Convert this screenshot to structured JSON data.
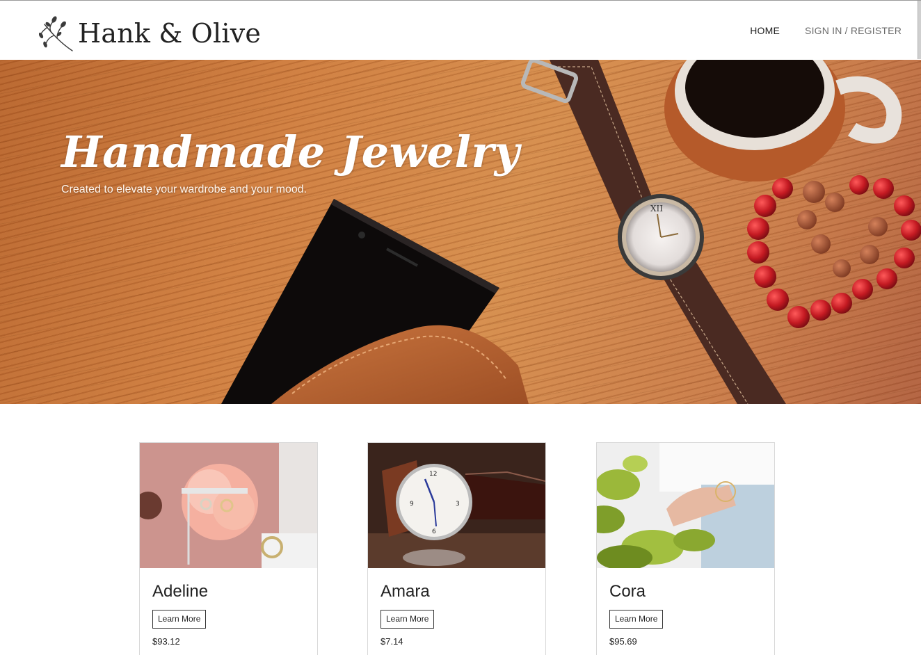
{
  "header": {
    "brand": "Hank & Olive",
    "nav": {
      "home": "HOME",
      "signin": "SIGN IN / REGISTER"
    }
  },
  "hero": {
    "title": "Handmade Jewelry",
    "subtitle": "Created to elevate your wardrobe and your mood."
  },
  "products": [
    {
      "name": "Adeline",
      "button": "Learn More",
      "price": "$93.12"
    },
    {
      "name": "Amara",
      "button": "Learn More",
      "price": "$7.14"
    },
    {
      "name": "Cora",
      "button": "Learn More",
      "price": "$95.69"
    }
  ],
  "icons": {
    "logo": "olive-branch-icon"
  },
  "colors": {
    "text": "#222222",
    "muted": "#6a6a6a",
    "border": "#d8d8d8",
    "hero_wood": "#c97c3f"
  }
}
